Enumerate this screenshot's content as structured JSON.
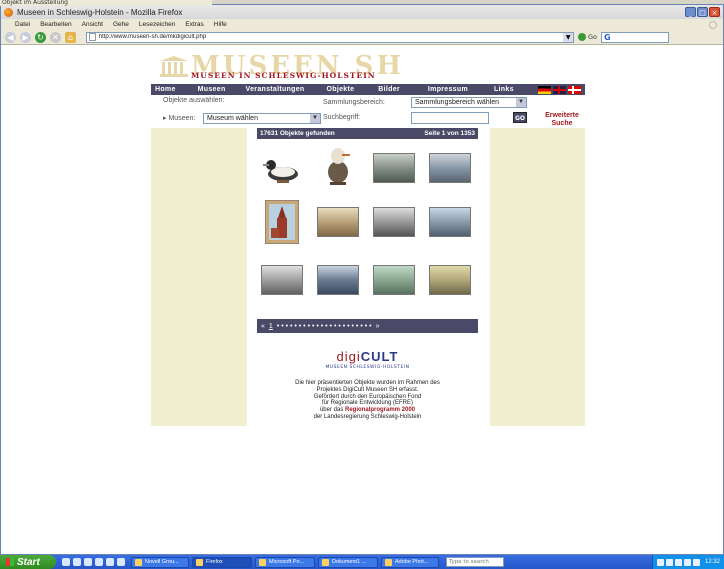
{
  "behind": {
    "top_text": "Objekt im Ausstellung"
  },
  "window": {
    "title": "Museen in Schleswig-Holstein - Mozilla Firefox",
    "menu": [
      "Datei",
      "Bearbeiten",
      "Ansicht",
      "Gehe",
      "Lesezeichen",
      "Extras",
      "Hilfe"
    ],
    "url": "http://www.museen-sh.de/mkdigicult.php",
    "go_label": "Go",
    "search_engine_icon": "G"
  },
  "site": {
    "logo_big": "MUSEEN SH",
    "logo_small": "MUSEEN IN SCHLESWIG-HOLSTEIN",
    "nav": [
      "Home",
      "Museen",
      "Veranstaltungen",
      "Objekte",
      "Bilder",
      "Impressum",
      "Links"
    ],
    "filters": {
      "objects_label": "Objekte auswählen:",
      "collection_label": "Sammlungsbereich:",
      "collection_value": "Sammlungsbereich wählen",
      "museum_label": "Museen:",
      "museum_value": "Museum wählen",
      "search_label": "Suchbegriff:",
      "go_label": "GO",
      "advanced_line1": "Erweiterte",
      "advanced_line2": "Suche"
    },
    "results": {
      "found": "17631 Objekte gefunden",
      "page": "Seite 1 von 1353"
    },
    "pager": {
      "prev": "«",
      "current": "1",
      "dots": "• • • • • • • • • • • • • • • • • • • • • •",
      "next": "»"
    },
    "digicult": {
      "logo_a": "digi",
      "logo_b": "CULT",
      "sub": "MUSEEN SCHLESWIG-HOLSTEIN",
      "line1": "Die hier präsentierten Objekte wurden im Rahmen des",
      "line2": "Projektes DigiCult Museen SH erfasst.",
      "line3": "Gefördert durch den Europäischen Fond",
      "line4": "für Regionale Entwicklung (EFRE)",
      "line5_a": "über das ",
      "line5_b": "Regionalprogramm 2000",
      "line6": "der Landesregierung Schleswig-Holstein"
    }
  },
  "taskbar": {
    "start": "Start",
    "tasks": [
      "Novell Grou...",
      "Firefox",
      "Microsoft Po...",
      "Dokument1 ...",
      "Adobe Phot..."
    ],
    "search_placeholder": "Type to search",
    "clock": "12:32"
  }
}
